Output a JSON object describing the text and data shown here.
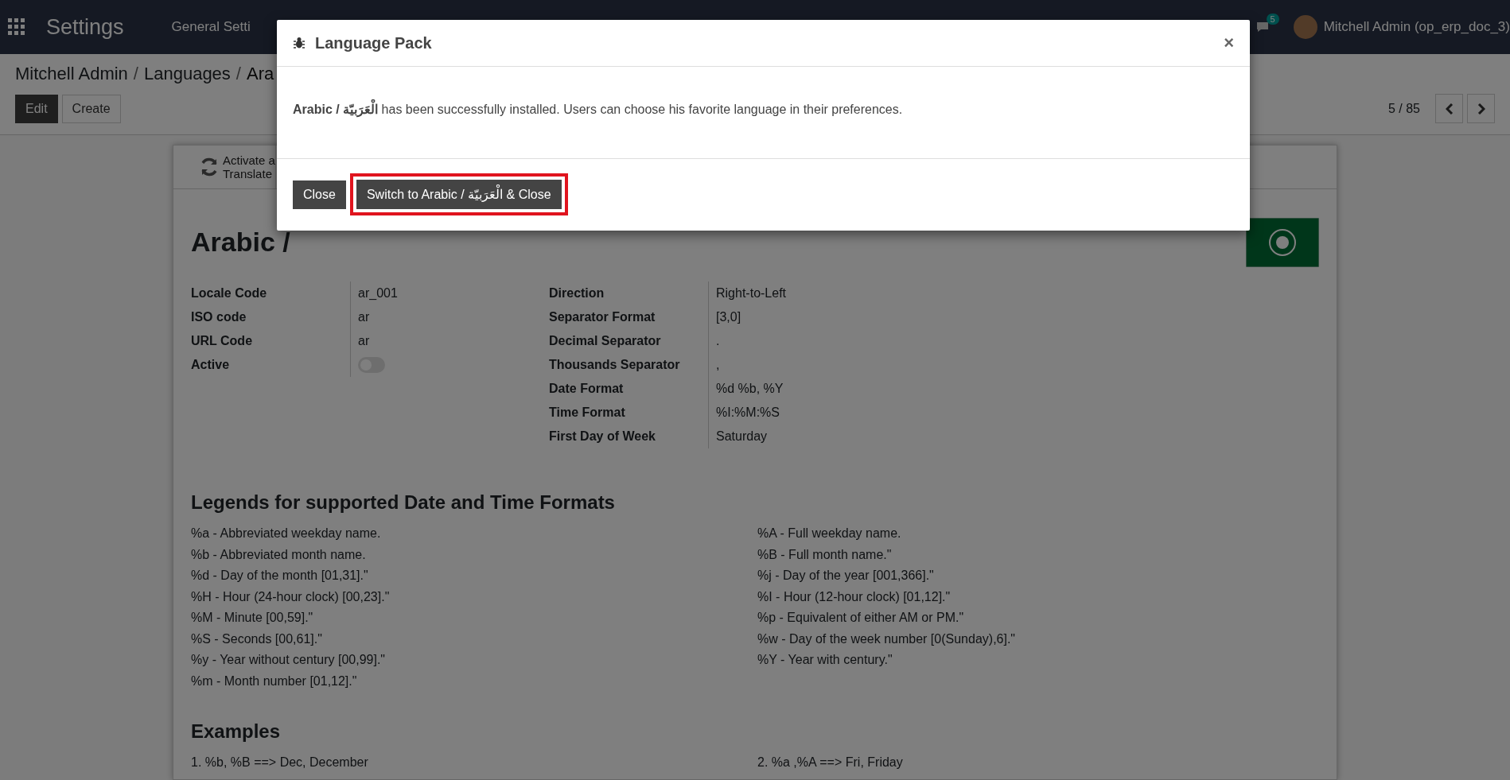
{
  "navbar": {
    "app_title": "Settings",
    "menu_items": [
      "General Setti"
    ],
    "badges": [
      "5"
    ],
    "user": "Mitchell Admin (op_erp_doc_3)"
  },
  "breadcrumb": [
    {
      "label": "Mitchell Admin"
    },
    {
      "separator": "/",
      "label": "Languages"
    },
    {
      "separator": "/",
      "label": "Ara"
    }
  ],
  "actions": [
    "Edit",
    "Create"
  ],
  "pager": {
    "text": "5 / 85"
  },
  "button_box": {
    "lines": [
      "Activate a",
      "Translate"
    ]
  },
  "record": {
    "title": "Arabic /",
    "left_fields": [
      {
        "label": "Locale Code",
        "value": "ar_001",
        "kind": "text"
      },
      {
        "label": "ISO code",
        "value": "ar",
        "kind": "text"
      },
      {
        "label": "URL Code",
        "value": "ar",
        "kind": "text"
      },
      {
        "label": "Active",
        "kind": "toggle",
        "on": false
      }
    ],
    "right_fields": [
      {
        "label": "Direction",
        "value": "Right-to-Left"
      },
      {
        "label": "Separator Format",
        "value": "[3,0]"
      },
      {
        "label": "Decimal Separator",
        "value": "."
      },
      {
        "label": "Thousands Separator",
        "value": ","
      },
      {
        "label": "Date Format",
        "value": "%d %b, %Y"
      },
      {
        "label": "Time Format",
        "value": "%I:%M:%S"
      },
      {
        "label": "First Day of Week",
        "value": "Saturday"
      }
    ]
  },
  "legends": {
    "title": "Legends for supported Date and Time Formats",
    "left": [
      "%a - Abbreviated weekday name.",
      "%b - Abbreviated month name.",
      "%d - Day of the month [01,31].\"",
      "%H - Hour (24-hour clock) [00,23].\"",
      "%M - Minute [00,59].\"",
      "%S - Seconds [00,61].\"",
      "%y - Year without century [00,99].\"",
      "%m - Month number [01,12].\""
    ],
    "right": [
      "%A - Full weekday name.",
      "%B - Full month name.\"",
      "%j - Day of the year [001,366].\"",
      "%I - Hour (12-hour clock) [01,12].\"",
      "%p - Equivalent of either AM or PM.\"",
      "%w - Day of the week number [0(Sunday),6].\"",
      "%Y - Year with century.\""
    ]
  },
  "examples": {
    "title": "Examples",
    "left": [
      "1. %b, %B ==> Dec, December"
    ],
    "right": [
      "2. %a ,%A ==> Fri, Friday"
    ]
  },
  "dialog": {
    "title": "Language Pack",
    "close_symbol": "×",
    "message": "**Arabic / الْعَرَبيّة** has been successfully installed. Users can choose his favorite language in their preferences.",
    "buttons": [
      {
        "label": "Close",
        "highlighted": false
      },
      {
        "label": "Switch to Arabic / الْعَرَبيّة & Close",
        "highlighted": true
      }
    ]
  }
}
